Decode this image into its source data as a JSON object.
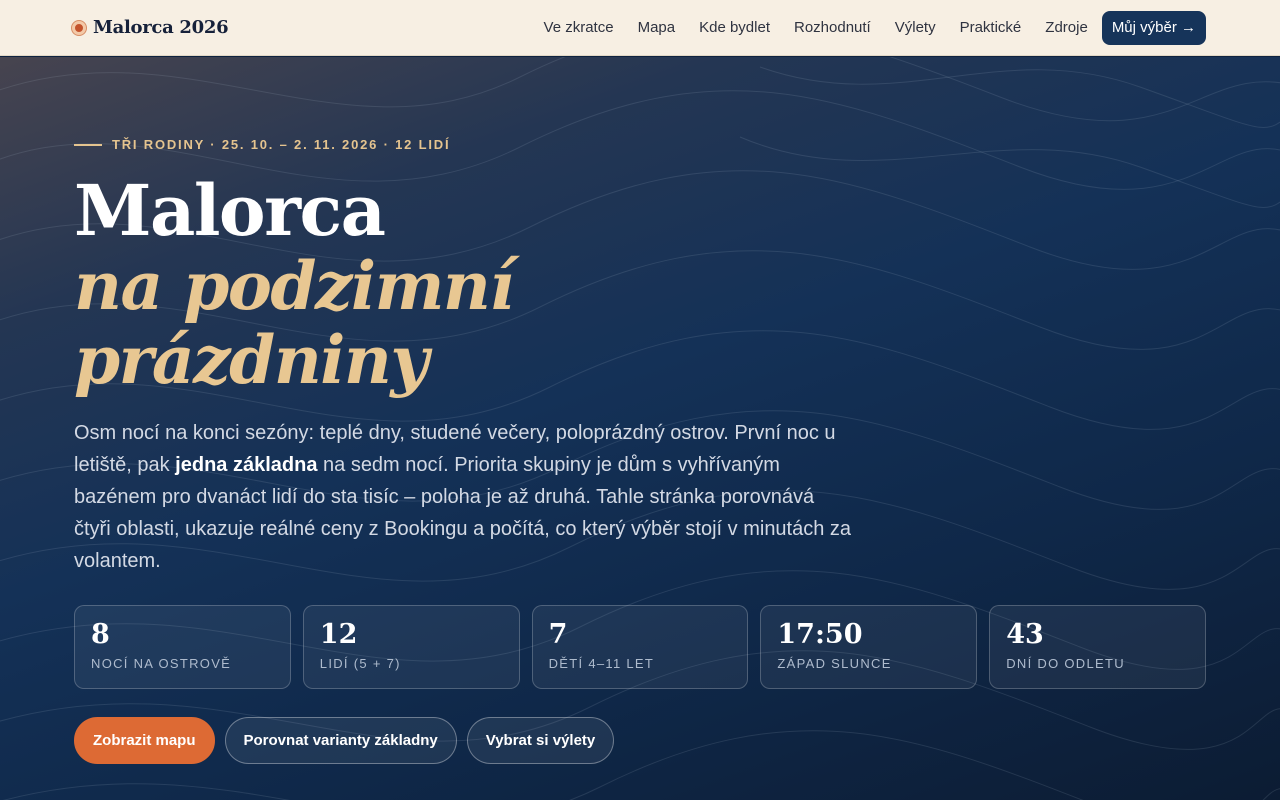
{
  "nav": {
    "brand": "Malorca 2026",
    "links": [
      "Ve zkratce",
      "Mapa",
      "Kde bydlet",
      "Rozhodnutí",
      "Výlety",
      "Praktické",
      "Zdroje"
    ],
    "cta": "Můj výběr →"
  },
  "hero": {
    "eyebrow": "TŘI RODINY · 25. 10. – 2. 11. 2026 · 12 LIDÍ",
    "title_main": "Malorca",
    "title_accent_1": "na podzimní",
    "title_accent_2": "prázdniny",
    "lead_part1": "Osm nocí na konci sezóny: teplé dny, studené večery, poloprázdný ostrov. První noc u letiště, pak ",
    "lead_strong": "jedna základna",
    "lead_part2": " na sedm nocí. Priorita skupiny je dům s vyhřívaným bazénem pro dvanáct lidí do sta tisíc – poloha je až druhá. Tahle stránka porovnává čtyři oblasti, ukazuje reálné ceny z Bookingu a počítá, co který výběr stojí v minutách za volantem."
  },
  "stats": [
    {
      "value": "8",
      "label": "NOCÍ NA OSTROVĚ"
    },
    {
      "value": "12",
      "label": "LIDÍ (5 + 7)"
    },
    {
      "value": "7",
      "label": "DĚTÍ 4–11 LET"
    },
    {
      "value": "17:50",
      "label": "ZÁPAD SLUNCE"
    },
    {
      "value": "43",
      "label": "DNÍ DO ODLETU"
    }
  ],
  "actions": {
    "primary": "Zobrazit mapu",
    "compare": "Porovnat varianty základny",
    "trips": "Vybrat si výlety"
  },
  "colors": {
    "nav_bg": "#f7efe3",
    "hero_bg": "#143157",
    "accent_gold": "#e5c48f",
    "primary_orange": "#dd6a34",
    "cta_navy": "#16345a"
  },
  "icons": {
    "brand": "sun-dot-icon",
    "cta_arrow": "arrow-right-icon"
  }
}
